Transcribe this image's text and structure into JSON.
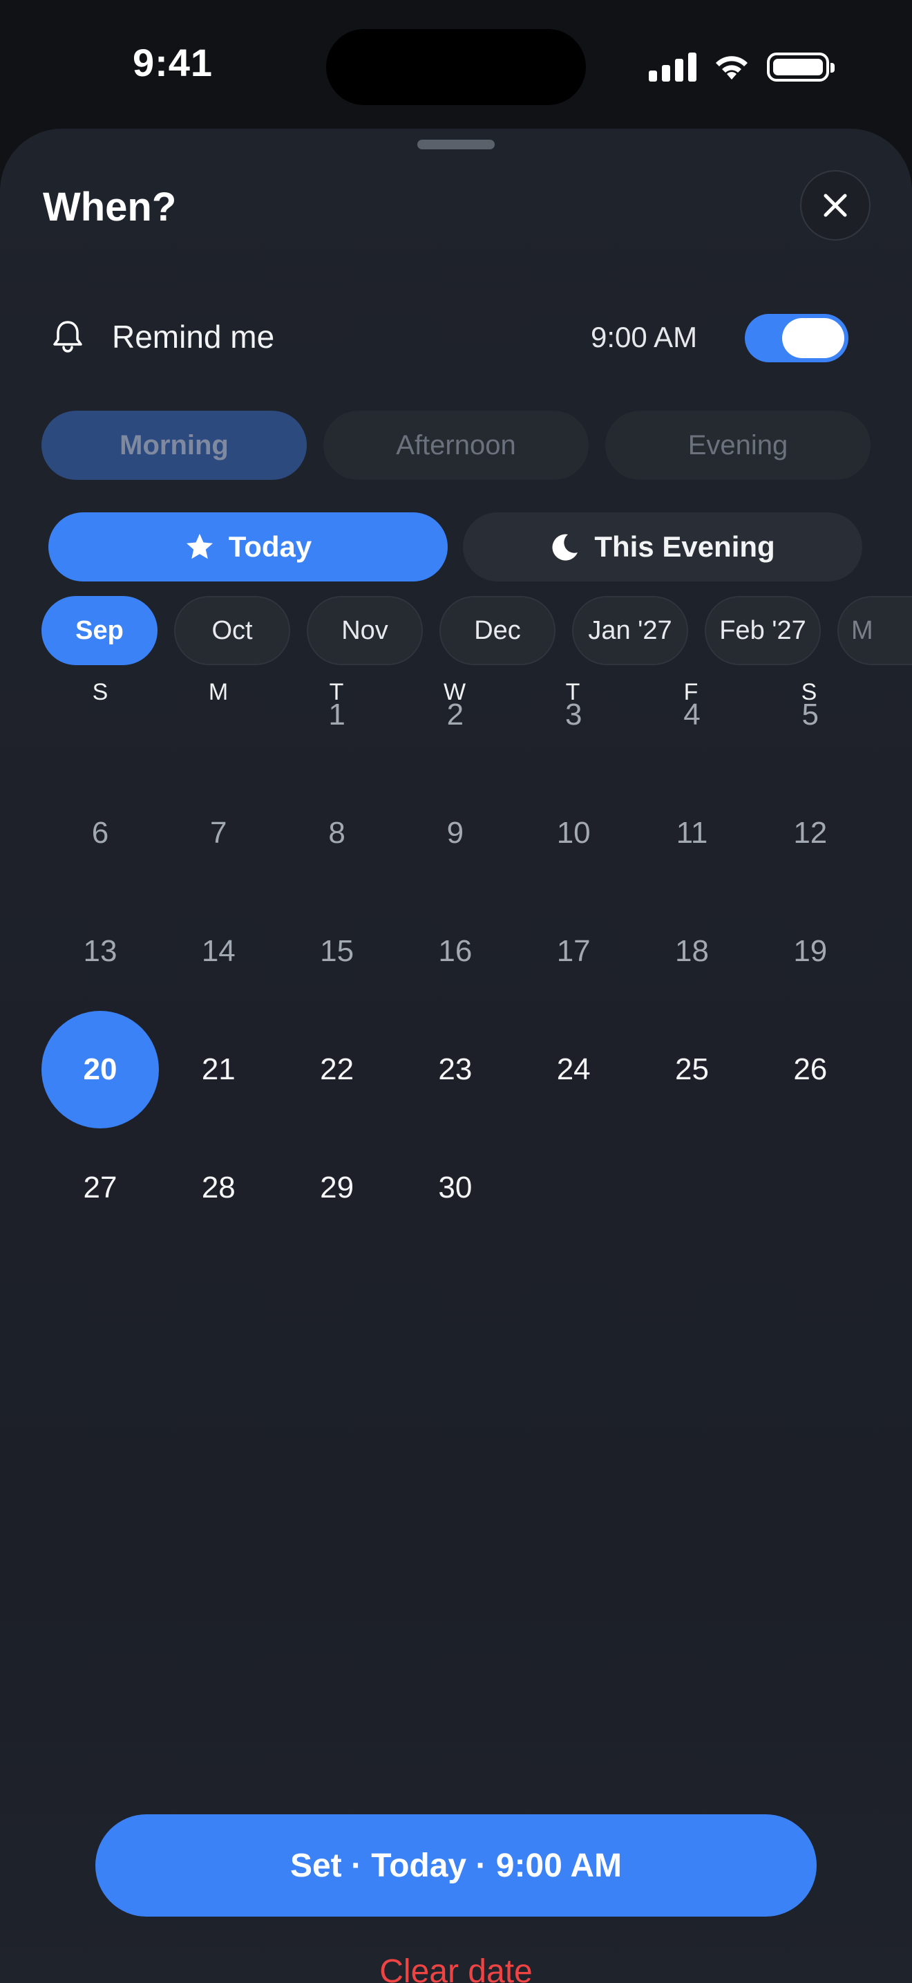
{
  "status_bar": {
    "time": "9:41"
  },
  "sheet": {
    "title": "When?",
    "close_icon": "close-icon"
  },
  "remind": {
    "label": "Remind me",
    "time": "9:00 AM",
    "enabled": true,
    "accent": "#3b82f6"
  },
  "periods": [
    {
      "label": "Morning",
      "active": true
    },
    {
      "label": "Afternoon",
      "active": false
    },
    {
      "label": "Evening",
      "active": false
    }
  ],
  "quick_picks": {
    "today": {
      "label": "Today",
      "icon": "star-icon"
    },
    "evening": {
      "label": "This Evening",
      "icon": "moon-icon"
    }
  },
  "months": [
    {
      "label": "Sep",
      "active": true
    },
    {
      "label": "Oct",
      "active": false
    },
    {
      "label": "Nov",
      "active": false
    },
    {
      "label": "Dec",
      "active": false
    },
    {
      "label": "Jan '27",
      "active": false
    },
    {
      "label": "Feb '27",
      "active": false
    },
    {
      "label": "M",
      "active": false
    }
  ],
  "calendar": {
    "weekdays": [
      "S",
      "M",
      "T",
      "W",
      "T",
      "F",
      "S"
    ],
    "first_weekday_index": 2,
    "days_in_month": 30,
    "selected_day": 20
  },
  "actions": {
    "set_label": "Set · Today · 9:00 AM",
    "clear_label": "Clear date",
    "clear_color": "#ef4444"
  }
}
